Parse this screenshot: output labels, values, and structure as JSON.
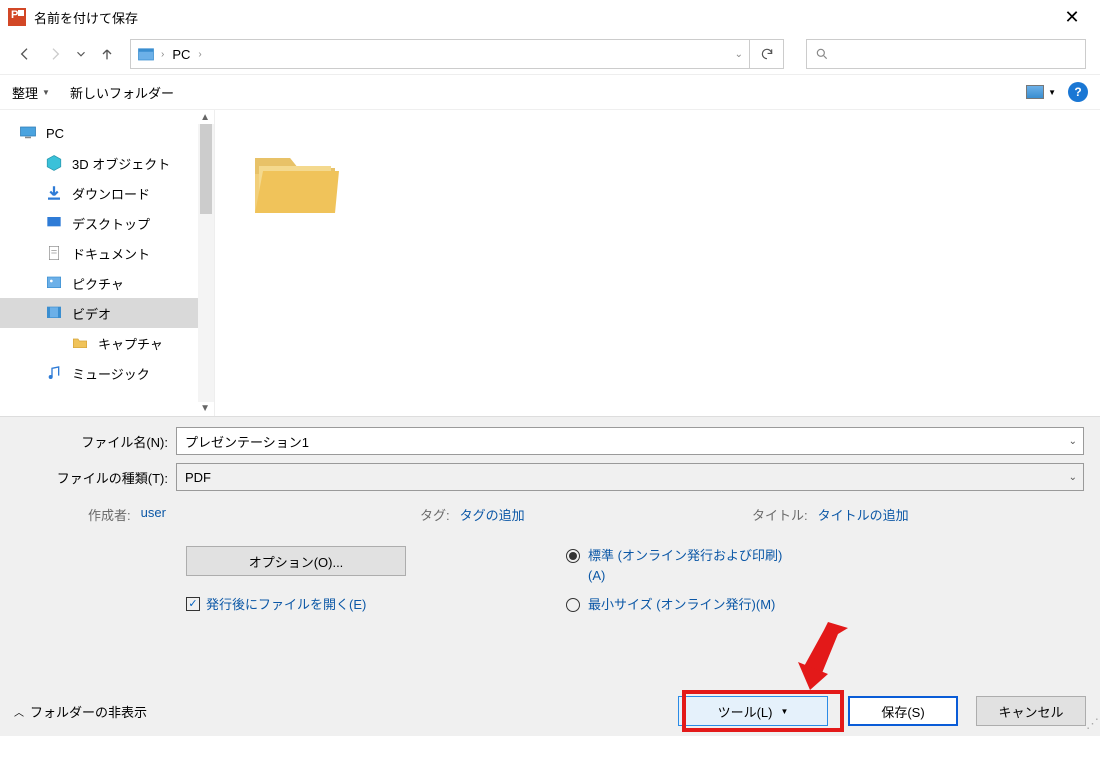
{
  "title": "名前を付けて保存",
  "breadcrumb": {
    "root": "PC"
  },
  "toolbar": {
    "organize": "整理",
    "newfolder": "新しいフォルダー"
  },
  "tree": {
    "pc": "PC",
    "objects3d": "3D オブジェクト",
    "downloads": "ダウンロード",
    "desktop": "デスクトップ",
    "documents": "ドキュメント",
    "pictures": "ピクチャ",
    "videos": "ビデオ",
    "capture": "キャプチャ",
    "music": "ミュージック"
  },
  "form": {
    "filename_label": "ファイル名(N):",
    "filename_value": "プレゼンテーション1",
    "filetype_label": "ファイルの種類(T):",
    "filetype_value": "PDF"
  },
  "meta": {
    "author_label": "作成者:",
    "author_value": "user",
    "tag_label": "タグ:",
    "tag_value": "タグの追加",
    "title_label": "タイトル:",
    "title_value": "タイトルの追加"
  },
  "options": {
    "options_btn": "オプション(O)...",
    "open_after": "発行後にファイルを開く(E)",
    "standard": "標準 (オンライン発行および印刷)(A)",
    "minimum": "最小サイズ (オンライン発行)(M)"
  },
  "actions": {
    "hide_folders": "フォルダーの非表示",
    "tools": "ツール(L)",
    "save": "保存(S)",
    "cancel": "キャンセル"
  }
}
